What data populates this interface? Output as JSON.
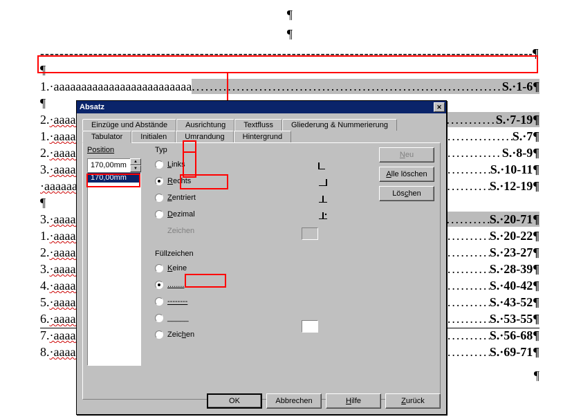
{
  "doc": {
    "lines": [
      {
        "num": "1.",
        "text": "·aaaaaaaaaaaaaaaaaaaaaaaaa",
        "page": "S.·1-6¶",
        "wavy": false,
        "hl": true
      },
      {
        "num": "2.",
        "text": "·aaaaaa",
        "page": "S.·7-19¶",
        "wavy": true,
        "hl": true
      },
      {
        "num": "1.",
        "text": "·aaaaaaa",
        "page": "S.·7¶",
        "wavy": true,
        "hl": false
      },
      {
        "num": "2.",
        "text": "·aaaaaaa",
        "page": "S.·8-9¶",
        "wavy": true,
        "hl": false
      },
      {
        "num": "3.",
        "text": "·aaaaaaa",
        "page": "S.·10-11¶",
        "wavy": true,
        "hl": false
      },
      {
        "num": "",
        "text": "·aaaaaaa",
        "page": "S.·12-19¶",
        "wavy": true,
        "hl": false
      },
      {
        "num": "3.",
        "text": "·aaaaaa",
        "page": "S.·20-71¶",
        "wavy": true,
        "hl": true
      },
      {
        "num": "1.",
        "text": "·aaaaaaa",
        "page": "S.·20-22¶",
        "wavy": true,
        "hl": false
      },
      {
        "num": "2.",
        "text": "·aaaaaaa",
        "page": "S.·23-27¶",
        "wavy": true,
        "hl": false
      },
      {
        "num": "3.",
        "text": "·aaaaaaa",
        "page": "S.·28-39¶",
        "wavy": true,
        "hl": false
      },
      {
        "num": "4.",
        "text": "·aaaaaaa",
        "page": "S.·40-42¶",
        "wavy": true,
        "hl": false
      },
      {
        "num": "5.",
        "text": "·aaaaaaa",
        "page": "S.·43-52¶",
        "wavy": true,
        "hl": false
      },
      {
        "num": "6.",
        "text": "·aaaaaaa",
        "page": "S.·53-55¶",
        "wavy": true,
        "hl": false
      },
      {
        "num": "7.",
        "text": "·aaaaaaa",
        "page": "S.·56-68¶",
        "wavy": true,
        "hl": false
      },
      {
        "num": "8.",
        "text": "·aaaaaaa",
        "page": "S.·69-71¶",
        "wavy": true,
        "hl": false
      }
    ],
    "pil": "¶",
    "dashfill": "-----------------------------------------------------------------------------------------------------------------------",
    "dots": "........................................................................................................................................."
  },
  "dialog": {
    "title": "Absatz",
    "tabs_row1": [
      "Einzüge und Abstände",
      "Ausrichtung",
      "Textfluss",
      "Gliederung & Nummerierung"
    ],
    "tabs_row2": [
      "Tabulator",
      "Initialen",
      "Umrandung",
      "Hintergrund"
    ],
    "active_tab": "Tabulator",
    "position_label": "Position",
    "position_value": "170,00mm",
    "list_selected": "170,00mm",
    "typ_label": "Typ",
    "typ_options": {
      "links": "Links",
      "rechts": "Rechts",
      "zentriert": "Zentriert",
      "dezimal": "Dezimal"
    },
    "typ_selected": "rechts",
    "zeichen_label": "Zeichen",
    "fuell_label": "Füllzeichen",
    "fuell_options": {
      "keine": "Keine",
      "dots": "........",
      "dashes": "--------",
      "under": "_____",
      "zeichen": "Zeichen"
    },
    "fuell_selected": "dots",
    "btn_neu": "Neu",
    "btn_alle": "Alle löschen",
    "btn_loeschen": "Löschen",
    "btn_ok": "OK",
    "btn_cancel": "Abbrechen",
    "btn_help": "Hilfe",
    "btn_back": "Zurück"
  }
}
